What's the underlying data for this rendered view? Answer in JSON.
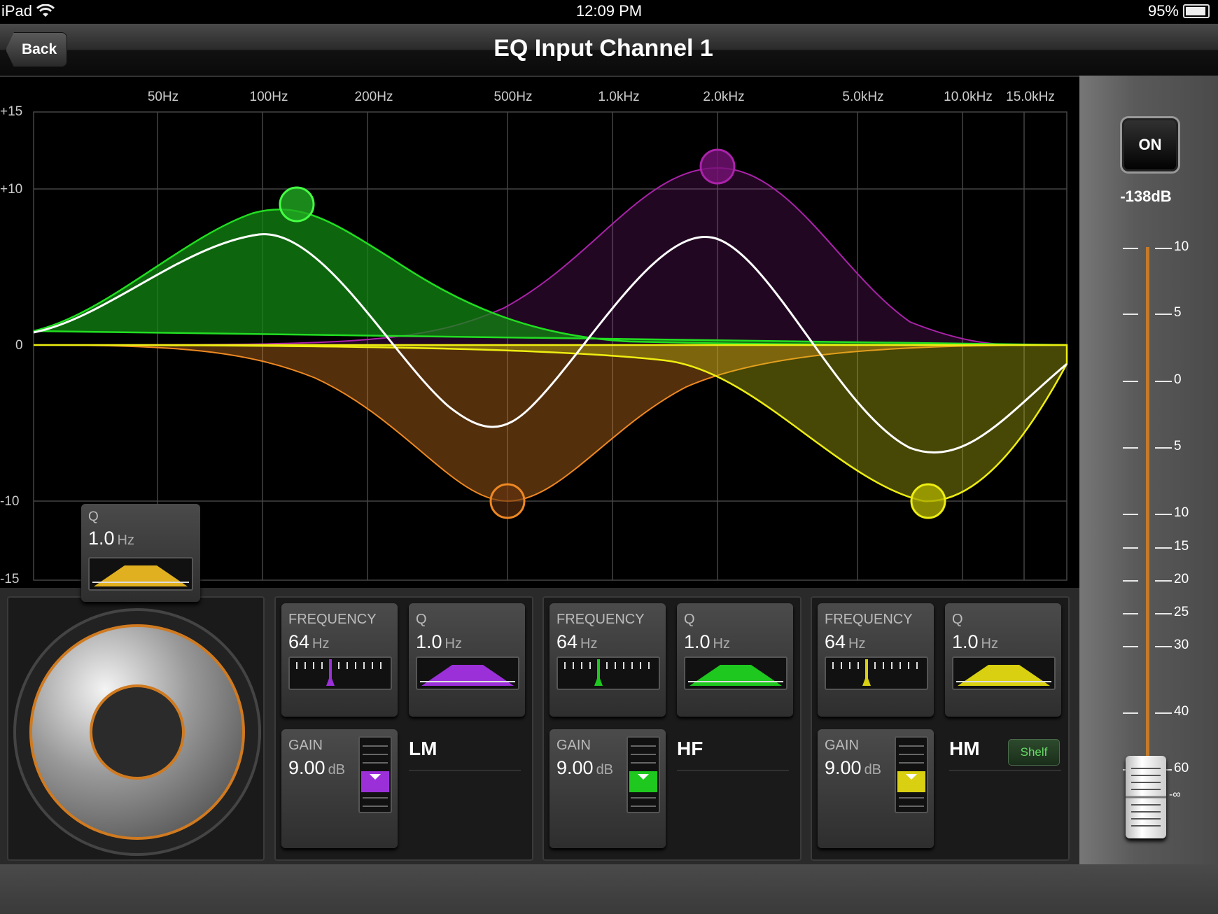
{
  "status_bar": {
    "device": "iPad",
    "time": "12:09 PM",
    "battery": "95%"
  },
  "nav": {
    "back_label": "Back",
    "title": "EQ Input Channel 1"
  },
  "graph": {
    "freq_labels": [
      "50Hz",
      "100Hz",
      "200Hz",
      "500Hz",
      "1.0kHz",
      "2.0kHz",
      "5.0kHz",
      "10.0kHz",
      "15.0kHz"
    ],
    "db_labels": [
      "+15",
      "+10",
      "0",
      "-10",
      "-15"
    ],
    "band_colors": {
      "green": "#22dd22",
      "purple": "#aa22aa",
      "orange": "#ee8822",
      "yellow": "#dddd11"
    }
  },
  "popup": {
    "label": "Q",
    "value": "1.0",
    "unit": "Hz"
  },
  "bands": {
    "lm": {
      "name": "LM",
      "freq_label": "FREQUENCY",
      "freq_value": "64",
      "freq_unit": "Hz",
      "q_label": "Q",
      "q_value": "1.0",
      "q_unit": "Hz",
      "gain_label": "GAIN",
      "gain_value": "9.00",
      "gain_unit": "dB",
      "color": "#9b30d9"
    },
    "hf": {
      "name": "HF",
      "freq_label": "FREQUENCY",
      "freq_value": "64",
      "freq_unit": "Hz",
      "q_label": "Q",
      "q_value": "1.0",
      "q_unit": "Hz",
      "gain_label": "GAIN",
      "gain_value": "9.00",
      "gain_unit": "dB",
      "color": "#1ec81e"
    },
    "hm": {
      "name": "HM",
      "freq_label": "FREQUENCY",
      "freq_value": "64",
      "freq_unit": "Hz",
      "q_label": "Q",
      "q_value": "1.0",
      "q_unit": "Hz",
      "gain_label": "GAIN",
      "gain_value": "9.00",
      "gain_unit": "dB",
      "color": "#d8d010",
      "shelf_label": "Shelf"
    }
  },
  "fader": {
    "on_label": "ON",
    "level": "-138dB",
    "scale": [
      "10",
      "5",
      "0",
      "5",
      "10",
      "15",
      "20",
      "25",
      "30",
      "40",
      "60",
      "-∞"
    ]
  }
}
